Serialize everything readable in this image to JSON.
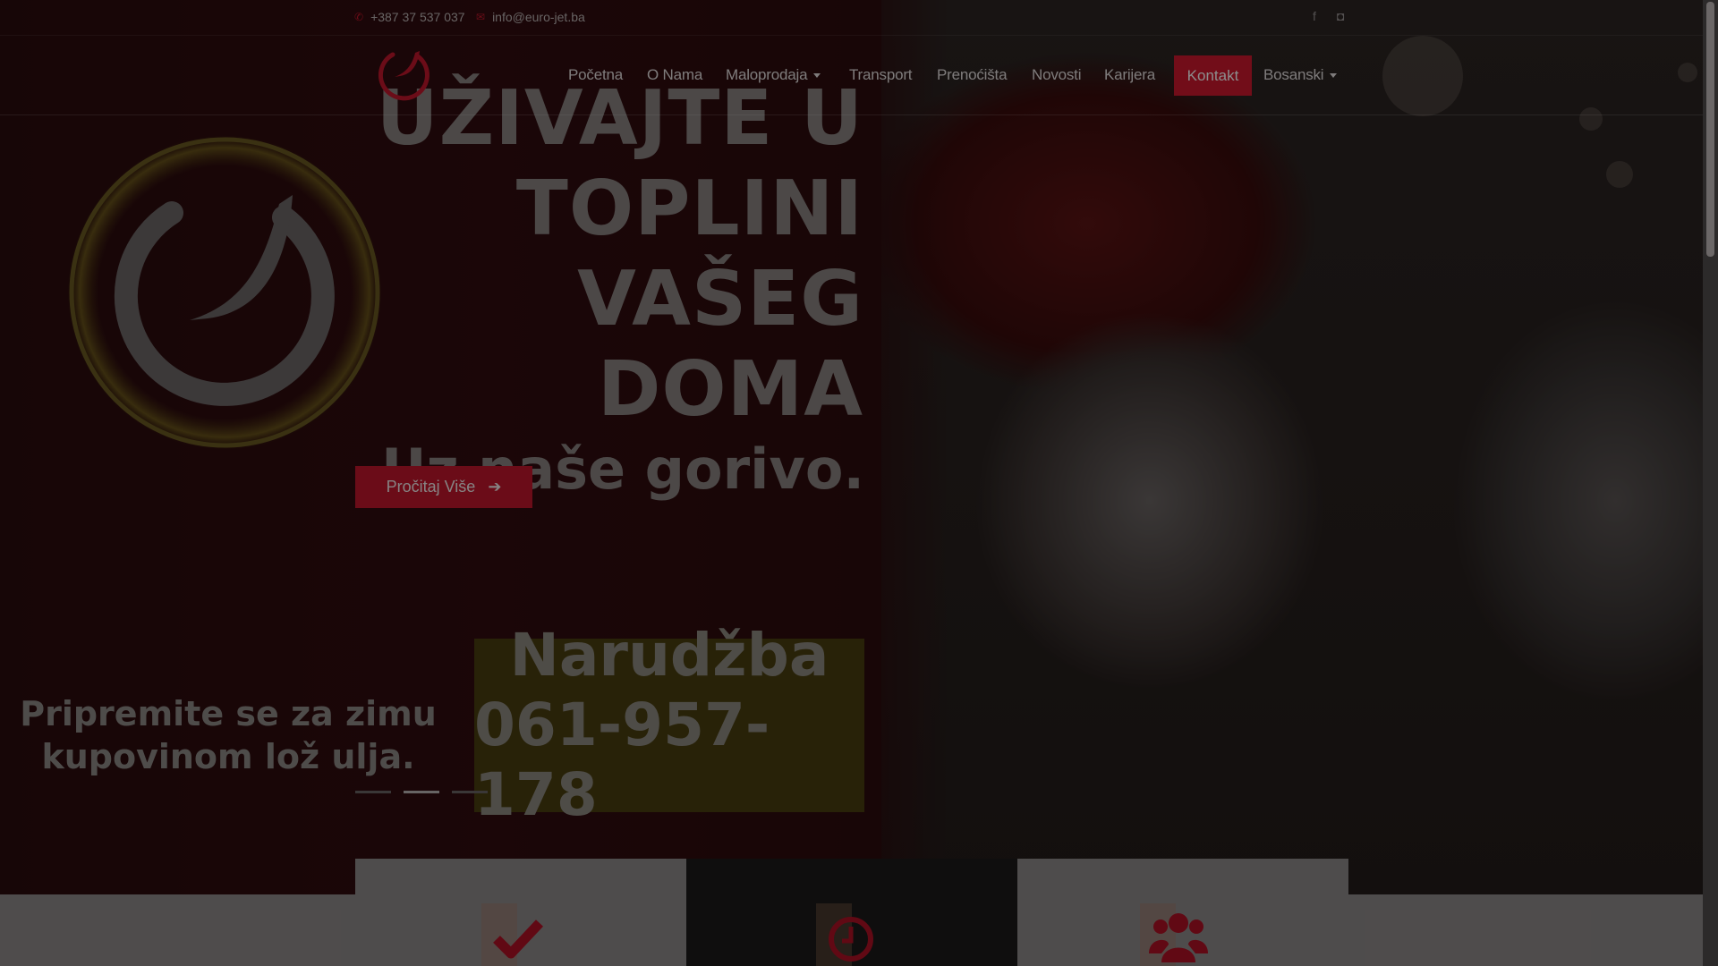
{
  "topbar": {
    "phone": "+387 37 537 037",
    "email": "info@euro-jet.ba",
    "phone_icon": "phone-icon",
    "email_icon": "envelope-icon",
    "social": [
      "facebook-icon",
      "instagram-icon"
    ]
  },
  "nav": {
    "items": [
      "Početna",
      "O Nama",
      "Maloprodaja",
      "Transport",
      "Prenoćišta",
      "Novosti",
      "Karijera"
    ],
    "cta": "Kontakt",
    "language": "Bosanski"
  },
  "hero": {
    "headline_lines": [
      "UŽIVAJTE U",
      "TOPLINI",
      "VAŠEG",
      "DOMA"
    ],
    "subheadline": "Uz naše gorivo.",
    "button": "Pročitaj Više",
    "winter_text_lines": [
      "Pripremite se za zimu",
      "kupovinom lož ulja."
    ],
    "order_title": "Narudžba",
    "order_phone": "061-957-178",
    "slides": 3,
    "active_slide": 2
  },
  "features": {
    "icons": [
      "checkmark-icon",
      "clock-icon",
      "users-icon"
    ]
  },
  "colors": {
    "brand_red": "#d0182e",
    "dark": "#1d1b1b"
  }
}
